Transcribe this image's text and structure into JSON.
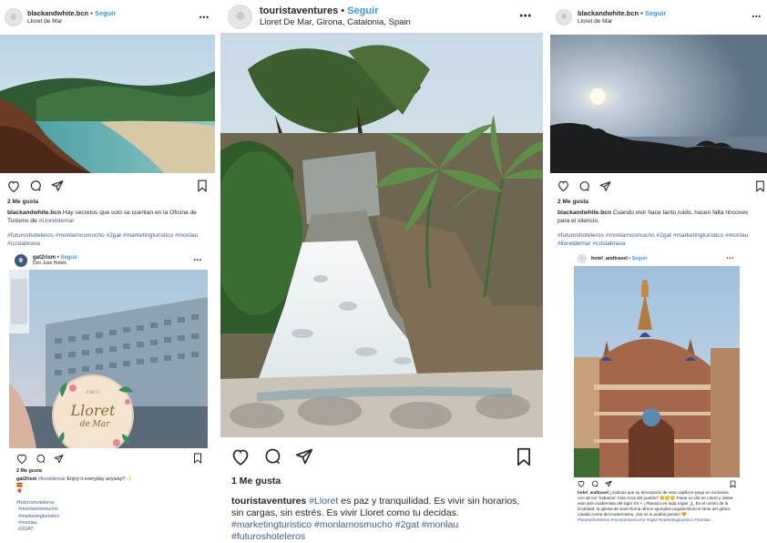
{
  "post1": {
    "username": "blackandwhite.bcn",
    "follow": "Seguir",
    "location": "Lloret de Mar",
    "likes": "2 Me gusta",
    "caption": "Hay secretos que solo se cuentan en la Oficina de Turismo de",
    "caption_tag": "#Lloretdemar",
    "hashtags": "#futuroshoteleros #monlamosmucho #2gat #marketingturistico #monlau #costabrava"
  },
  "post2": {
    "username": "gat2rism",
    "follow": "Seguir",
    "location": "Don Juan Hotels",
    "likes": "2 Me gusta",
    "caption_tag": "#lloretdemar",
    "caption": "Enjoy it everyday anyway!! ✨",
    "emoji_line1": "🇪🇸",
    "emoji_line2": "🎈",
    "hashtags": [
      "#futuroshoteleros",
      "#monlamosmucho",
      "#marketingturistico",
      "#monlau",
      "#2GAT"
    ],
    "coaster": {
      "small": "l'ACU",
      "main": "Lloret",
      "sub": "de Mar"
    }
  },
  "post3": {
    "username": "touristaventures",
    "follow": "Seguir",
    "location": "Lloret De Mar, Girona, Catalonia, Spain",
    "likes": "1 Me gusta",
    "caption_tag1": "#Lloret",
    "caption": "es paz y tranquilidad. Es vivir sin horarios, sin cargas, sin estrés. Es vivir Lloret como tu decidas.",
    "hashtags": "#marketingturistico #monlamosmucho #2gat #monlau #futuroshoteleros"
  },
  "post4": {
    "username": "blackandwhite.bcn",
    "follow": "Seguir",
    "location": "Lloret de Mar",
    "likes": "2 Me gusta",
    "caption": "Cuando vivir hace tanto ruido, hacen falta rincones para el silencio.",
    "hashtags": "#futuroshoteleros #monlamosmucho #2gat #marketingturistico #monlau #lloretdemar #costabrava"
  },
  "post5": {
    "username": "hotel_andtravel",
    "follow": "Seguir",
    "caption": "¿Sabíais que su decoración de esta capilla le pega en exclusiva uno de los \"indianos\" más ricos del pueblo? 😊😊😊 Pasar un día en Lloret y visitar este arte modernista del siglo XX » ¡ Planazo en toda regla! 🙏🏼 En el centro de la localidad, la iglesia de Sant Romà ofrece ejemplos arquitectónicos tanto del gótico catalán como del modernismo. ¡No os lo podéis perder! 🧡",
    "hashtags": "#futuroshoteleros #monlamosmucho #2gat #marketingturistico #monlau"
  },
  "sep": "•",
  "more": "•••"
}
